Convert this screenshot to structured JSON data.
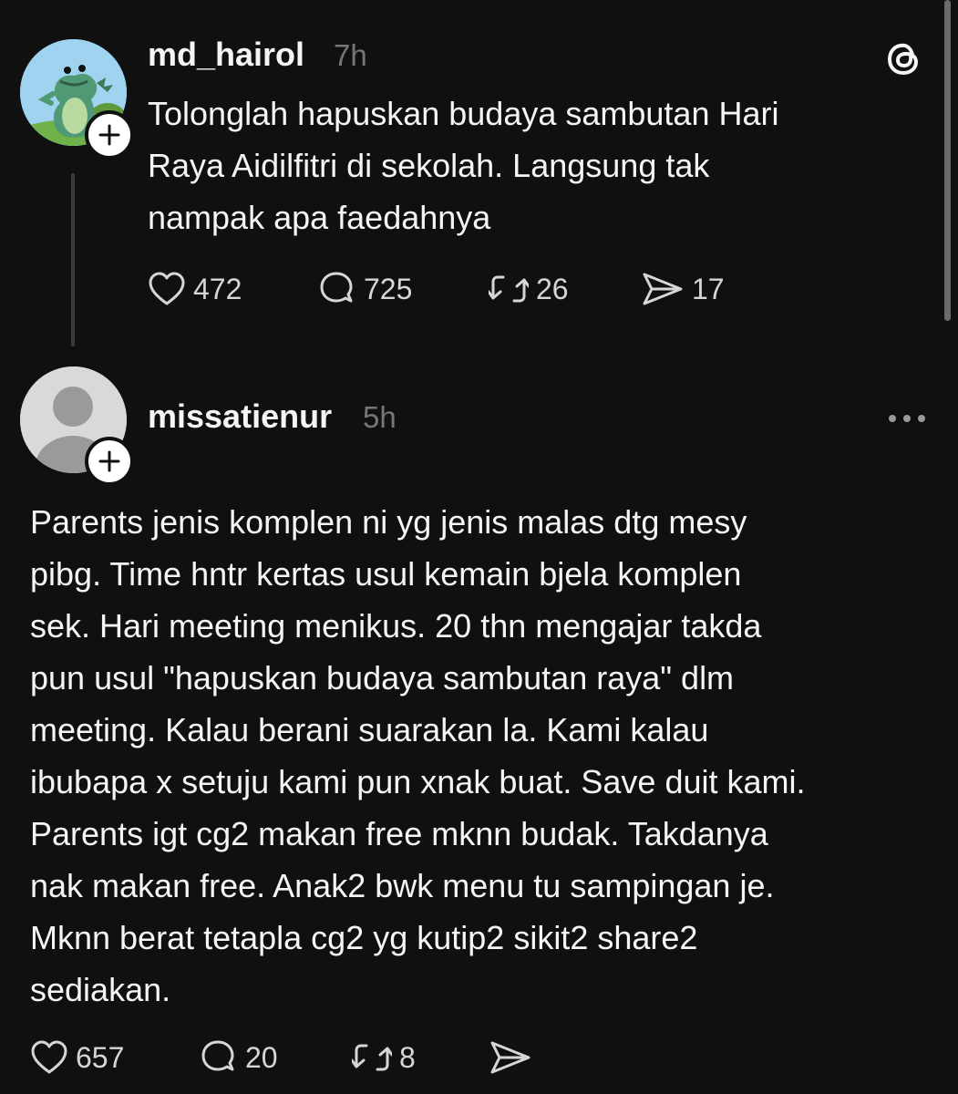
{
  "posts": [
    {
      "username": "md_hairol",
      "time": "7h",
      "text": "Tolonglah hapuskan budaya sambutan Hari\nRaya Aidilfitri di sekolah. Langsung tak\nnampak apa faedahnya",
      "likes": "472",
      "replies": "725",
      "reposts": "26",
      "shares": "17"
    },
    {
      "username": "missatienur",
      "time": "5h",
      "text": "Parents jenis komplen ni yg jenis malas dtg mesy\npibg. Time hntr kertas usul kemain bjela komplen\nsek. Hari meeting menikus. 20 thn mengajar takda\npun usul \"hapuskan budaya sambutan raya\" dlm\nmeeting. Kalau berani suarakan la. Kami kalau\nibubapa x setuju kami pun xnak buat. Save duit kami.\nParents igt cg2 makan free mknn budak. Takdanya\nnak makan free. Anak2 bwk menu tu sampingan je.\nMknn berat tetapla cg2 yg kutip2 sikit2 share2\nsediakan.",
      "likes": "657",
      "replies": "20",
      "reposts": "8"
    }
  ],
  "icons": {
    "app": "threads-logo-icon",
    "more": "more-horizontal-icon",
    "like": "heart-icon",
    "reply": "comment-icon",
    "repost": "repost-icon",
    "share": "send-icon",
    "follow": "plus-icon"
  },
  "colors": {
    "background": "#101010",
    "text": "#f3f5f7",
    "muted": "#777777"
  }
}
